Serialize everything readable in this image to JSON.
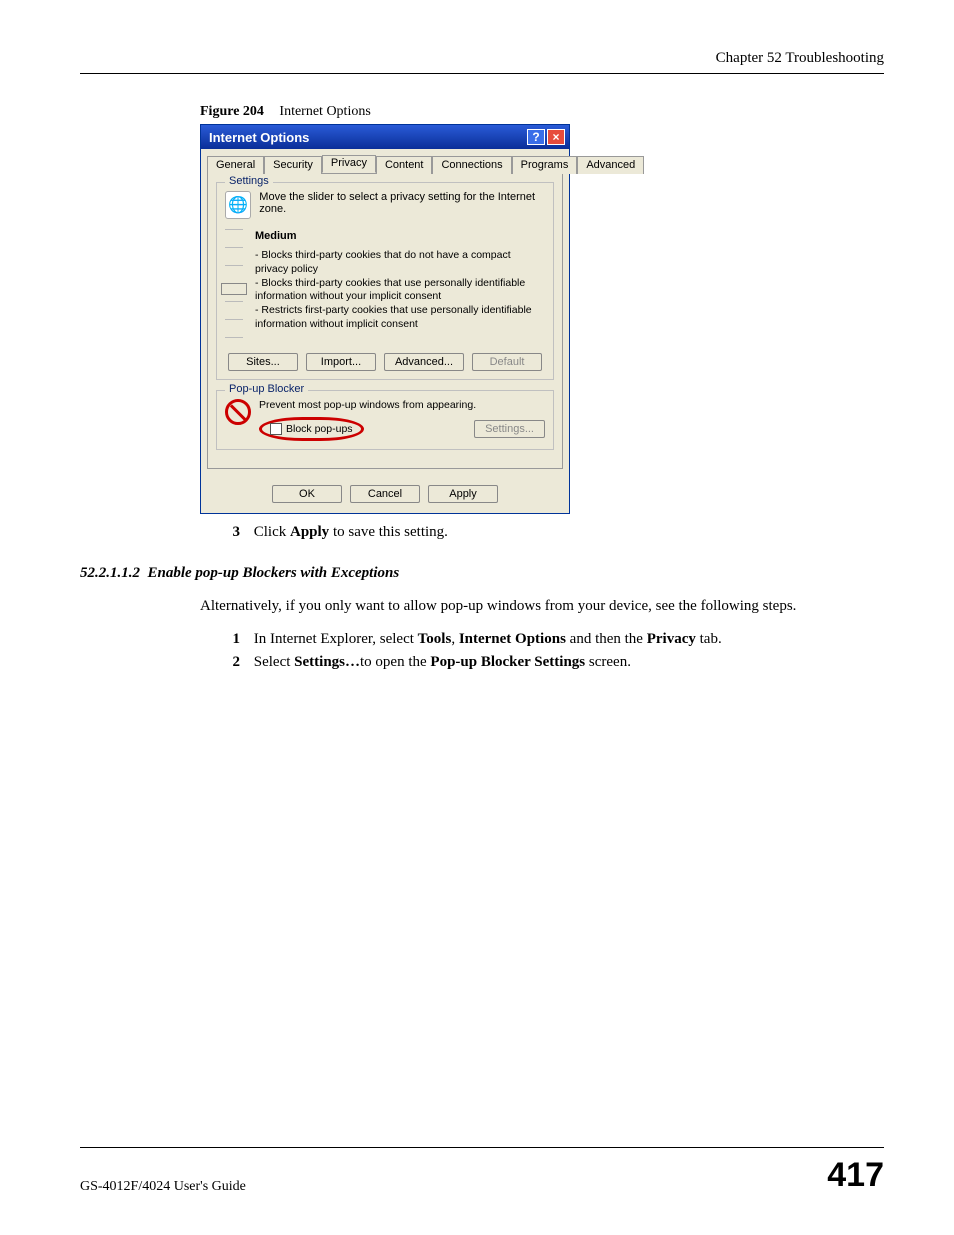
{
  "header": {
    "chapter": "Chapter 52 Troubleshooting"
  },
  "figure": {
    "label": "Figure 204",
    "title": "Internet Options"
  },
  "dialog": {
    "title": "Internet Options",
    "tabs": [
      "General",
      "Security",
      "Privacy",
      "Content",
      "Connections",
      "Programs",
      "Advanced"
    ],
    "active_tab": "Privacy",
    "settings": {
      "legend": "Settings",
      "instruction": "Move the slider to select a privacy setting for the Internet zone.",
      "level": "Medium",
      "desc1": "- Blocks third-party cookies that do not have a compact privacy policy",
      "desc2": "- Blocks third-party cookies that use personally identifiable information without your implicit consent",
      "desc3": "- Restricts first-party cookies that use personally identifiable information without implicit consent",
      "buttons": {
        "sites": "Sites...",
        "import": "Import...",
        "advanced": "Advanced...",
        "default": "Default"
      }
    },
    "popup": {
      "legend": "Pop-up Blocker",
      "desc": "Prevent most pop-up windows from appearing.",
      "checkbox": "Block pop-ups",
      "settings_btn": "Settings..."
    },
    "buttons": {
      "ok": "OK",
      "cancel": "Cancel",
      "apply": "Apply"
    }
  },
  "step3": {
    "num": "3",
    "text_pre": "Click ",
    "bold": "Apply",
    "text_post": " to save this setting."
  },
  "section": {
    "num": "52.2.1.1.2",
    "title": "Enable pop-up Blockers with Exceptions"
  },
  "alt_para": "Alternatively, if you only want to allow pop-up windows from your device, see the following steps.",
  "step1": {
    "num": "1",
    "pre": "In Internet Explorer, select ",
    "b1": "Tools",
    "sep1": ", ",
    "b2": "Internet Options",
    "sep2": " and then the ",
    "b3": "Privacy",
    "post": " tab."
  },
  "step2": {
    "num": "2",
    "pre": "Select ",
    "b1": "Settings…",
    "mid": "to open the ",
    "b2": "Pop-up Blocker Settings",
    "post": " screen."
  },
  "footer": {
    "guide": "GS-4012F/4024 User's Guide",
    "page": "417"
  }
}
